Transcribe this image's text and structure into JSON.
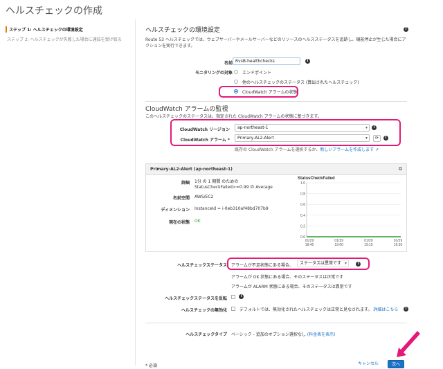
{
  "page": {
    "title": "ヘルスチェックの作成"
  },
  "sidebar": {
    "steps": [
      "ステップ 1: ヘルスチェックの環境設定",
      "ステップ 2: ヘルスチェックが失敗した場合に通知を受け取る"
    ]
  },
  "config": {
    "heading": "ヘルスチェックの環境設定",
    "description": "Route 53 ヘルスチェックでは、ウェブサーバーやメールサーバーなどのリソースのヘルスステータスを追跡し、機能停止が生じた場合にアクションを実行できます。",
    "name_label": "名前",
    "name_value": "RvsB-healthchecks",
    "monitor_label": "モニタリングの対象",
    "monitor_options": [
      "エンドポイント",
      "他のヘルスチェックのステータス (算出されたヘルスチェック)",
      "CloudWatch アラームの状態"
    ]
  },
  "cloudwatch": {
    "heading": "CloudWatch アラームの監視",
    "description": "このヘルスチェックのステータスは、指定された CloudWatch アラームの状態に基づきます。",
    "region_label": "CloudWatch リージョン",
    "region_value": "ap-northeast-1",
    "alarm_label": "CloudWatch アラーム *",
    "alarm_value": "Primary-AL2-Alert",
    "help_prefix": "既存の CloudWatch アラームを選択するか、",
    "help_link": "新しいアラームを作成します"
  },
  "alarm_panel": {
    "title": "Primary-AL2-Alert (ap-northeast-1)",
    "details_label": "詳細",
    "details_value": "1分 の 1 期間 のための StatusCheckFailed>=0.99 の Average",
    "namespace_label": "名前空間",
    "namespace_value": "AWS/EC2",
    "dimension_label": "ディメンション",
    "dimension_value": "InstanceId = i-0eb310af48bd707b9",
    "state_label": "現在の状態",
    "state_value": "OK"
  },
  "chart_data": {
    "type": "line",
    "title": "StatusCheckFailed",
    "x": [
      "01/29 18:45",
      "01/29 19:00",
      "01/29 19:15",
      "01/29 19:30"
    ],
    "y_ticks": [
      "1.0",
      "0.8",
      "0.6",
      "0.4",
      "0.2",
      "0.0"
    ],
    "ylim": [
      0,
      1
    ],
    "series": [
      {
        "values": [
          0,
          0,
          0,
          0
        ]
      }
    ],
    "colors": {
      "series": "#2e9e2e"
    }
  },
  "status": {
    "label": "ヘルスチェックステータス",
    "insufficient_prefix": "アラームが不足状態にある場合、",
    "insufficient_select": "ステータスは異常です",
    "ok_line": "アラームが OK 状態にある場合、そのステータスは正常です",
    "alarm_line": "アラームが ALARM 状態にある場合、そのステータスは異常です",
    "invert_label": "ヘルスチェックステータスを反転",
    "disable_label": "ヘルスチェックの無効化",
    "disable_text": "デフォルトでは、無効化されたヘルスチェックは正常と見なされます。",
    "disable_link": "詳細はこちら",
    "type_label": "ヘルスチェックタイプ",
    "type_text": "ベーシック - 追加のオプション選択なし",
    "type_link": "(料金表を表示)"
  },
  "footer": {
    "required_note": "* 必須",
    "cancel": "キャンセル",
    "next": "次へ"
  },
  "colors": {
    "highlight": "#e3197a",
    "primary": "#1a73c7",
    "active_step": "#e07b00"
  }
}
